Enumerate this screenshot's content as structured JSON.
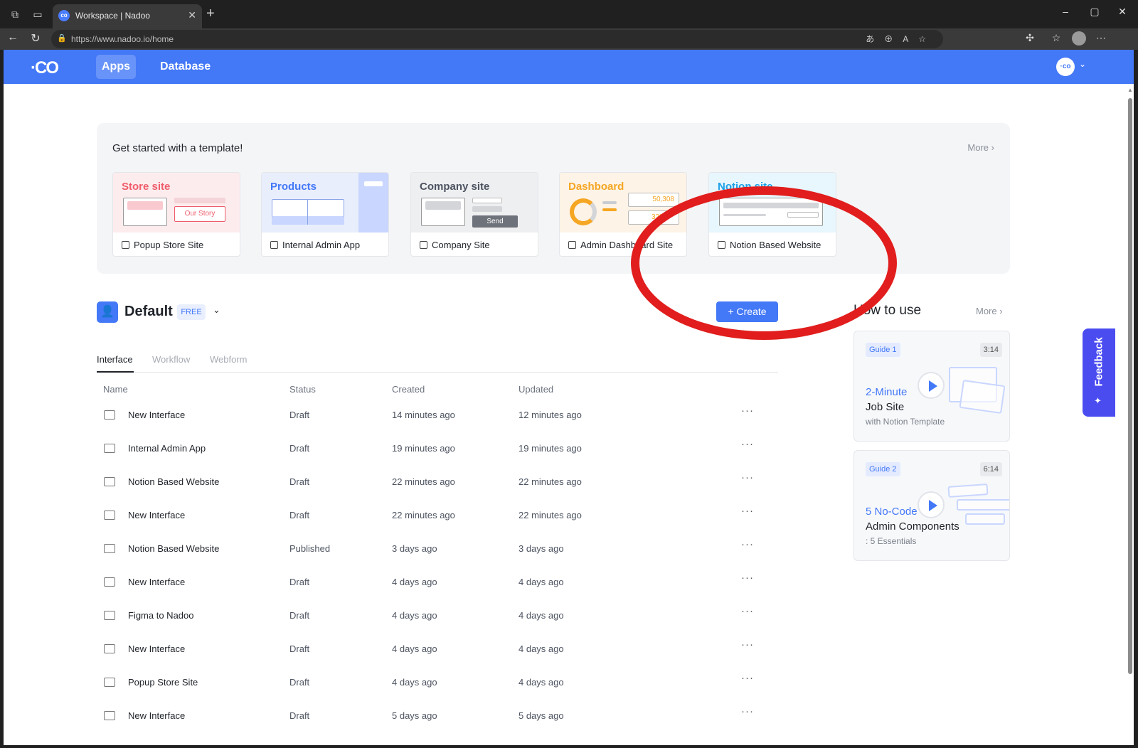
{
  "browser": {
    "tab_title": "Workspace | Nadoo",
    "url": "https://www.nadoo.io/home"
  },
  "appbar": {
    "logo": "·CO",
    "nav": [
      "Apps",
      "Database"
    ],
    "avatar": "·co"
  },
  "templates": {
    "heading": "Get started with a template!",
    "more": "More",
    "cards": [
      {
        "title": "Store site",
        "label": "Popup Store Site",
        "mini_text": "Our Story",
        "color": "#ef5d6b"
      },
      {
        "title": "Products",
        "label": "Internal Admin App",
        "color": "#4378f7"
      },
      {
        "title": "Company site",
        "label": "Company Site",
        "mini_text": "Send",
        "color": "#4d5360"
      },
      {
        "title": "Dashboard",
        "label": "Admin Dashboard Site",
        "mini_values": [
          "50,308",
          "32%"
        ],
        "color": "#f5a623"
      },
      {
        "title": "Notion site",
        "label": "Notion Based Website",
        "color": "#1aa0e6"
      }
    ]
  },
  "workspace": {
    "name": "Default",
    "badge": "FREE",
    "create_label": "Create",
    "tabs": [
      "Interface",
      "Workflow",
      "Webform"
    ]
  },
  "table": {
    "headers": [
      "Name",
      "Status",
      "Created",
      "Updated"
    ],
    "rows": [
      {
        "name": "New Interface",
        "status": "Draft",
        "created": "14 minutes ago",
        "updated": "12 minutes ago"
      },
      {
        "name": "Internal Admin App",
        "status": "Draft",
        "created": "19 minutes ago",
        "updated": "19 minutes ago"
      },
      {
        "name": "Notion Based Website",
        "status": "Draft",
        "created": "22 minutes ago",
        "updated": "22 minutes ago"
      },
      {
        "name": "New Interface",
        "status": "Draft",
        "created": "22 minutes ago",
        "updated": "22 minutes ago"
      },
      {
        "name": "Notion Based Website",
        "status": "Published",
        "created": "3 days ago",
        "updated": "3 days ago"
      },
      {
        "name": "New Interface",
        "status": "Draft",
        "created": "4 days ago",
        "updated": "4 days ago"
      },
      {
        "name": "Figma to Nadoo",
        "status": "Draft",
        "created": "4 days ago",
        "updated": "4 days ago"
      },
      {
        "name": "New Interface",
        "status": "Draft",
        "created": "4 days ago",
        "updated": "4 days ago"
      },
      {
        "name": "Popup Store Site",
        "status": "Draft",
        "created": "4 days ago",
        "updated": "4 days ago"
      },
      {
        "name": "New Interface",
        "status": "Draft",
        "created": "5 days ago",
        "updated": "5 days ago"
      }
    ],
    "more_glyph": "···"
  },
  "how_to_use": {
    "title": "How to use",
    "more": "More",
    "guides": [
      {
        "tag": "Guide 1",
        "time": "3:14",
        "line1": "2-Minute",
        "line2": "Job Site",
        "line3": "with Notion Template"
      },
      {
        "tag": "Guide 2",
        "time": "6:14",
        "line1": "5 No-Code",
        "line2": "Admin Components",
        "line3": ": 5 Essentials"
      }
    ]
  },
  "feedback": {
    "label": "Feedback"
  },
  "colors": {
    "brand": "#4378f7",
    "annotation": "#e11d1d",
    "feedback": "#4b4cf0"
  },
  "icons": [
    "back-icon",
    "reload-icon",
    "lock-icon",
    "play-icon",
    "grid-icon",
    "interface-icon",
    "plus-icon",
    "chevron-down-icon",
    "chevron-right-icon",
    "more-icon",
    "sparkle-icon"
  ]
}
